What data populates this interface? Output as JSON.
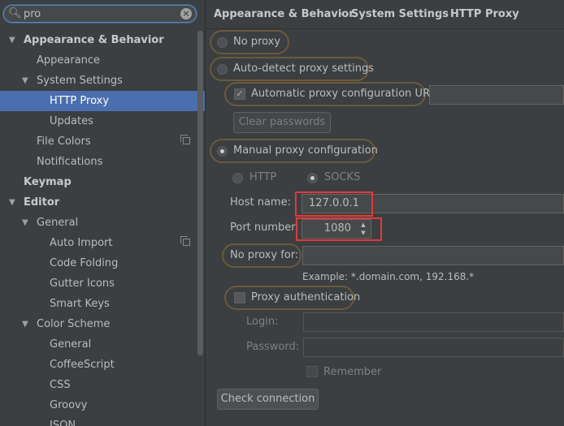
{
  "search": {
    "value": "pro",
    "search_icon": "search-icon",
    "clear_icon": "clear-icon"
  },
  "tree": [
    {
      "label": "Appearance & Behavior",
      "arrow": "▼"
    },
    {
      "label": "Appearance"
    },
    {
      "label": "System Settings",
      "arrow": "▼"
    },
    {
      "label": "HTTP Proxy"
    },
    {
      "label": "Updates"
    },
    {
      "label": "File Colors"
    },
    {
      "label": "Notifications"
    },
    {
      "label": "Keymap"
    },
    {
      "label": "Editor",
      "arrow": "▼"
    },
    {
      "label": "General",
      "arrow": "▼"
    },
    {
      "label": "Auto Import"
    },
    {
      "label": "Code Folding"
    },
    {
      "label": "Gutter Icons"
    },
    {
      "label": "Smart Keys"
    },
    {
      "label": "Color Scheme",
      "arrow": "▼"
    },
    {
      "label": "General"
    },
    {
      "label": "CoffeeScript"
    },
    {
      "label": "CSS"
    },
    {
      "label": "Groovy"
    },
    {
      "label": "JSON"
    }
  ],
  "breadcrumb": {
    "items": [
      "Appearance & Behavior",
      "System Settings",
      "HTTP Proxy"
    ],
    "separator": "›"
  },
  "proxy": {
    "no_proxy": "No proxy",
    "auto_detect": "Auto-detect proxy settings",
    "auto_config_url_label": "Automatic proxy configuration URL:",
    "auto_config_url_value": "",
    "clear_passwords": "Clear passwords",
    "manual": "Manual proxy configuration",
    "http": "HTTP",
    "socks": "SOCKS",
    "host_label": "Host name:",
    "host_value": "127.0.0.1",
    "port_label": "Port number:",
    "port_value": "1080",
    "no_proxy_for_label": "No proxy for:",
    "no_proxy_for_value": "",
    "example": "Example: *.domain.com, 192.168.*",
    "auth_label": "Proxy authentication",
    "login_label": "Login:",
    "password_label": "Password:",
    "remember_label": "Remember",
    "check_connection": "Check connection"
  },
  "colors": {
    "selection": "#4b6eaf",
    "highlight_box": "#e0393b",
    "option_outline": "#6a5a3c",
    "background": "#3c3f41"
  }
}
